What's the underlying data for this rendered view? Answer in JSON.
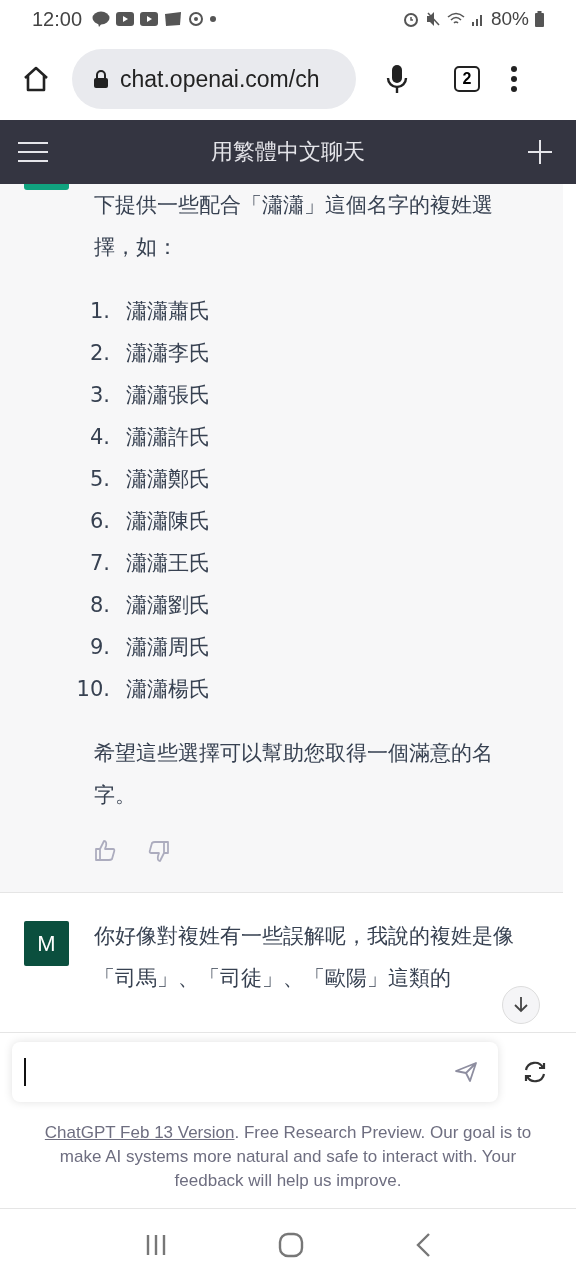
{
  "status_bar": {
    "time": "12:00",
    "battery": "80%"
  },
  "browser": {
    "url": "chat.openai.com/ch",
    "tab_count": "2"
  },
  "app_header": {
    "title": "用繁體中文聊天"
  },
  "messages": [
    {
      "kind": "assistant",
      "paragraphs": [
        "下提供一些配合「瀟瀟」這個名字的複姓選擇，如："
      ],
      "list": [
        {
          "number": "1.",
          "text": "瀟瀟蕭氏"
        },
        {
          "number": "2.",
          "text": "瀟瀟李氏"
        },
        {
          "number": "3.",
          "text": "瀟瀟張氏"
        },
        {
          "number": "4.",
          "text": "瀟瀟許氏"
        },
        {
          "number": "5.",
          "text": "瀟瀟鄭氏"
        },
        {
          "number": "6.",
          "text": "瀟瀟陳氏"
        },
        {
          "number": "7.",
          "text": "瀟瀟王氏"
        },
        {
          "number": "8.",
          "text": "瀟瀟劉氏"
        },
        {
          "number": "9.",
          "text": "瀟瀟周氏"
        },
        {
          "number": "10.",
          "text": "瀟瀟楊氏"
        }
      ],
      "closing": "希望這些選擇可以幫助您取得一個滿意的名字。"
    },
    {
      "kind": "user",
      "avatar": "M",
      "text": "你好像對複姓有一些誤解呢，我說的複姓是像「司馬」、「司徒」、「歐陽」這類的"
    }
  ],
  "footer": {
    "link": "ChatGPT Feb 13 Version",
    "text": ". Free Research Preview. Our goal is to make AI systems more natural and safe to interact with. Your feedback will help us improve."
  }
}
